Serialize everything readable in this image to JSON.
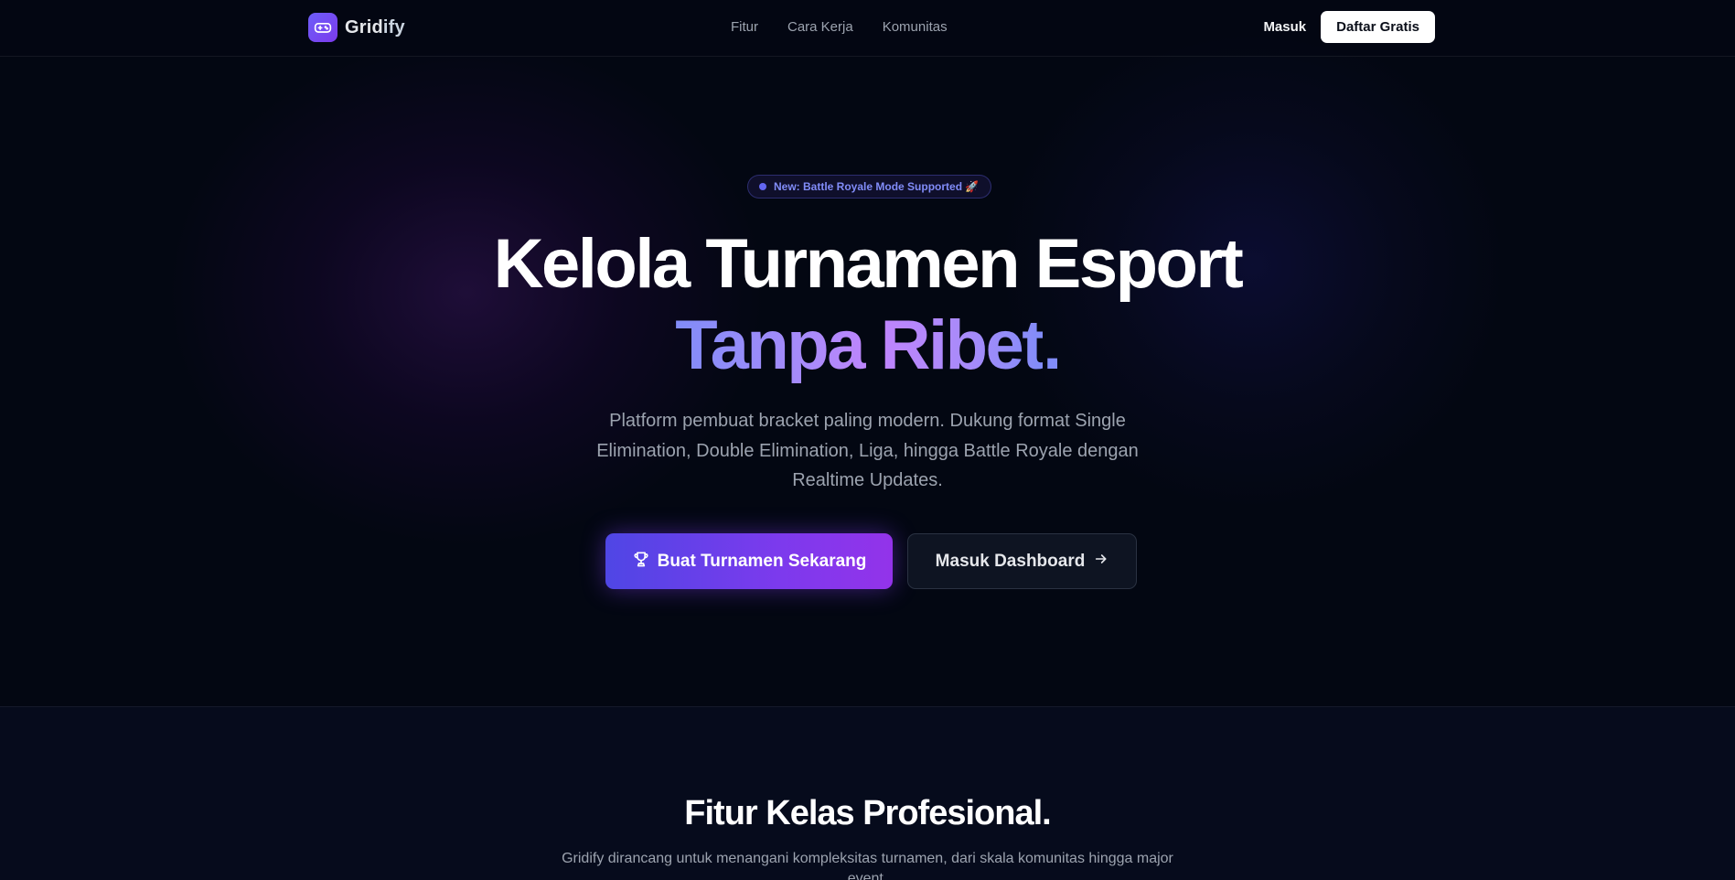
{
  "brand": {
    "name_main": "Grid",
    "name_rest": "ify",
    "logo_icon": "gamepad-icon"
  },
  "nav": {
    "links": [
      "Fitur",
      "Cara Kerja",
      "Komunitas"
    ],
    "login": "Masuk",
    "signup": "Daftar Gratis"
  },
  "hero": {
    "badge": "New: Battle Royale Mode Supported 🚀",
    "title_line1": "Kelola Turnamen Esport",
    "title_line2": "Tanpa Ribet",
    "title_dot": ".",
    "subtitle": "Platform pembuat bracket paling modern. Dukung format Single Elimination, Double Elimination, Liga, hingga Battle Royale dengan Realtime Updates.",
    "cta_primary": "Buat Turnamen Sekarang",
    "cta_primary_icon": "trophy-icon",
    "cta_secondary": "Masuk Dashboard",
    "cta_secondary_icon": "arrow-right-icon"
  },
  "features": {
    "title": "Fitur Kelas Profesional.",
    "subtitle": "Gridify dirancang untuk menangani kompleksitas turnamen, dari skala komunitas hingga major event."
  },
  "colors": {
    "background": "#030712",
    "accent": "#7c3aed",
    "accent_light": "#818cf8",
    "text_muted": "#9ca3af"
  }
}
